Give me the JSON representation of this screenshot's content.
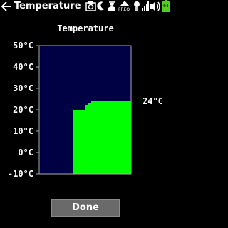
{
  "statusbar": {
    "title": "Temperature",
    "freq_label": "FREQ",
    "battery_label": "64"
  },
  "chart_title": "Temperature",
  "current_temp": "24°C",
  "done_label": "Done",
  "colors": {
    "plot_bg": "#000044",
    "fill": "#00ff00",
    "axis": "#aaaaaa",
    "button_bg": "#6a6a6a",
    "battery": "#55cc22"
  },
  "chart_data": {
    "type": "area",
    "title": "Temperature",
    "ylim": [
      -10,
      50
    ],
    "yticks": [
      50,
      40,
      30,
      20,
      10,
      0,
      -10
    ],
    "ytick_labels": [
      "50°C",
      "40°C",
      "30°C",
      "20°C",
      "10°C",
      "0°C",
      "-10°C"
    ],
    "x": [
      0,
      1,
      2,
      3,
      4,
      5,
      6,
      7,
      8,
      9,
      10,
      11,
      12,
      13,
      14,
      15,
      16,
      17,
      18,
      19,
      20,
      21,
      22,
      23,
      24,
      25,
      26,
      27,
      28,
      29
    ],
    "values": [
      null,
      null,
      null,
      null,
      null,
      null,
      null,
      null,
      null,
      null,
      null,
      20,
      20,
      20,
      20,
      22,
      23,
      24,
      24,
      24,
      24,
      24,
      24,
      24,
      24,
      24,
      24,
      24,
      24,
      24
    ],
    "current_value": 24,
    "current_label": "24°C",
    "grid": false
  }
}
